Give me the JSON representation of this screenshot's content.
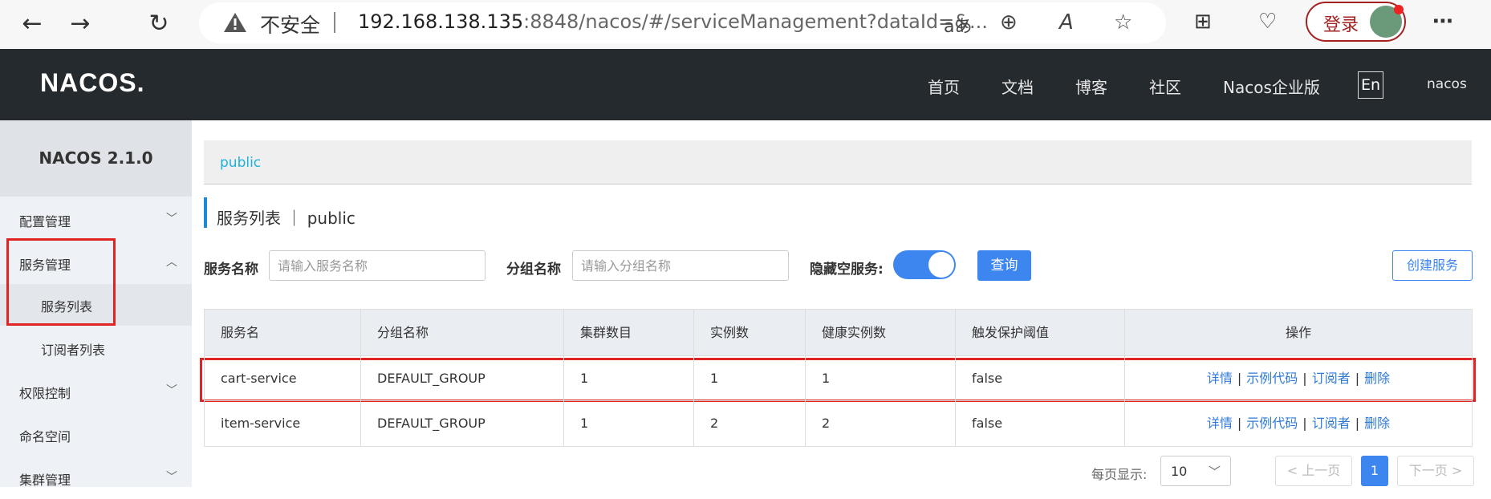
{
  "browser": {
    "back_icon": "arrow-left-icon",
    "not_secure_label": "不安全",
    "url_host": "192.168.138.135",
    "url_rest": ":8848/nacos/#/serviceManagement?dataId=&...",
    "read_aloud_icon": "aあ",
    "login_label": "登录"
  },
  "header": {
    "logo": "NACOS.",
    "nav": [
      "首页",
      "文档",
      "博客",
      "社区",
      "Nacos企业版"
    ],
    "lang": "En",
    "user": "nacos"
  },
  "sidebar": {
    "version": "NACOS 2.1.0",
    "items": [
      {
        "label": "配置管理",
        "chevron": "﹀"
      },
      {
        "label": "服务管理",
        "chevron": "︿"
      },
      {
        "label": "服务列表"
      },
      {
        "label": "订阅者列表"
      },
      {
        "label": "权限控制",
        "chevron": "﹀"
      },
      {
        "label": "命名空间"
      },
      {
        "label": "集群管理",
        "chevron": "﹀"
      }
    ]
  },
  "main": {
    "namespace": "public",
    "title": "服务列表 ｜ public",
    "filters": {
      "service_name_label": "服务名称",
      "service_name_placeholder": "请输入服务名称",
      "group_name_label": "分组名称",
      "group_name_placeholder": "请输入分组名称",
      "hide_empty_label": "隐藏空服务:",
      "query_label": "查询",
      "create_label": "创建服务"
    },
    "table": {
      "columns": [
        "服务名",
        "分组名称",
        "集群数目",
        "实例数",
        "健康实例数",
        "触发保护阈值",
        "操作"
      ],
      "rows": [
        {
          "name": "cart-service",
          "group": "DEFAULT_GROUP",
          "clusters": "1",
          "instances": "1",
          "healthy": "1",
          "threshold": "false"
        },
        {
          "name": "item-service",
          "group": "DEFAULT_GROUP",
          "clusters": "1",
          "instances": "2",
          "healthy": "2",
          "threshold": "false"
        }
      ],
      "ops": [
        "详情",
        "示例代码",
        "订阅者",
        "删除"
      ],
      "op_sep": "|"
    },
    "pager": {
      "per_page_label": "每页显示:",
      "per_page_value": "10",
      "prev_label": "< 上一页",
      "current_page": "1",
      "next_label": "下一页 >"
    }
  },
  "colors": {
    "accent": "#3d86f0",
    "header_bg": "#252a2f",
    "highlight_red": "#e02424",
    "link": "#2f7ad6"
  }
}
